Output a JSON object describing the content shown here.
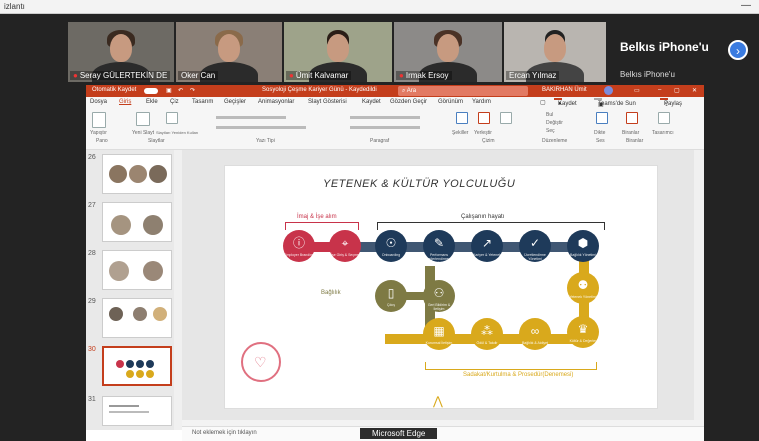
{
  "window": {
    "title": "izlantı"
  },
  "participants": [
    {
      "name": "Seray GÜLERTEKİN DE",
      "muted": true
    },
    {
      "name": "Oker Can",
      "muted": false
    },
    {
      "name": "Ümit Kalvamar",
      "muted": true
    },
    {
      "name": "Irmak Ersoy",
      "muted": true
    },
    {
      "name": "Ercan Yılmaz",
      "muted": false
    }
  ],
  "side_participant": {
    "name": "Belkıs iPhone'u",
    "sub": "Belkıs iPhone'u"
  },
  "powerpoint": {
    "autosave_label": "Otomatik Kaydet",
    "doc_title": "Sosyoloji Çeşme Kariyer Günü - Kaydedildi",
    "search_placeholder": "Ara",
    "user": "BAKIRHAN Ümit",
    "tabs": [
      "Dosya",
      "Giriş",
      "Ekle",
      "Çiz",
      "Tasarım",
      "Geçişler",
      "Animasyonlar",
      "Slayt Gösterisi",
      "Kaydet",
      "Gözden Geçir",
      "Görünüm",
      "Yardım"
    ],
    "active_tab": "Giriş",
    "record_btn": "Kaydet",
    "teams_btn": "Teams'de Sun",
    "share_btn": "Paylaş",
    "ribbon_groups": [
      "Pano",
      "Slaytlar",
      "Yazı Tipi",
      "Paragraf",
      "Çizim",
      "Düzenleme",
      "Ses",
      "Biranlar"
    ],
    "ribbon_items": [
      "Yapıştır",
      "Yeni Slayt",
      "Slaytları Yeniden Kullan",
      "Şekiller",
      "Yerleştir",
      "Bul",
      "Değiştir",
      "Seç",
      "Dikte",
      "Biranlar",
      "Tasarımcı"
    ],
    "slide_numbers": [
      "26",
      "27",
      "28",
      "29",
      "30",
      "31"
    ],
    "notes_placeholder": "Not eklemek için tıklayın",
    "taskbar_label": "Microsoft Edge"
  },
  "slide": {
    "title": "YETENEK & KÜLTÜR YOLCULUĞU",
    "brand_label": "İmaj & İşe alım",
    "employee_label": "Çalışanın hayatı",
    "loyalty_label": "Bağlılık",
    "exit_label": "Sadakat/Kurtulma & Prosedür(Denemesi)",
    "red_nodes": [
      "Employer Branding",
      "İşe Giriş & Seçme"
    ],
    "navy_nodes": [
      "Onboarding",
      "Performans Değerlendirme & Gelişim",
      "Kariyer & Yetenek",
      "Ücretlendirme Yönetimi",
      "Bağlılık Yönetimi"
    ],
    "olive_nodes": [
      "Çıkış",
      "Geri Bildirim & İletişim"
    ],
    "gold_nodes": [
      "Yetenek Yönetimi",
      "Kültür & Değerler",
      "Bağlılık & Aidiyet",
      "Ödül & Takdir",
      "Kurumsal İletişim",
      "İç İletişim",
      "Yan Haklar"
    ],
    "colors": {
      "red": "#c8334a",
      "navy": "#1e3a5a",
      "olive": "#7e7a44",
      "gold": "#d9a91c",
      "ppt": "#c43e1c"
    }
  }
}
